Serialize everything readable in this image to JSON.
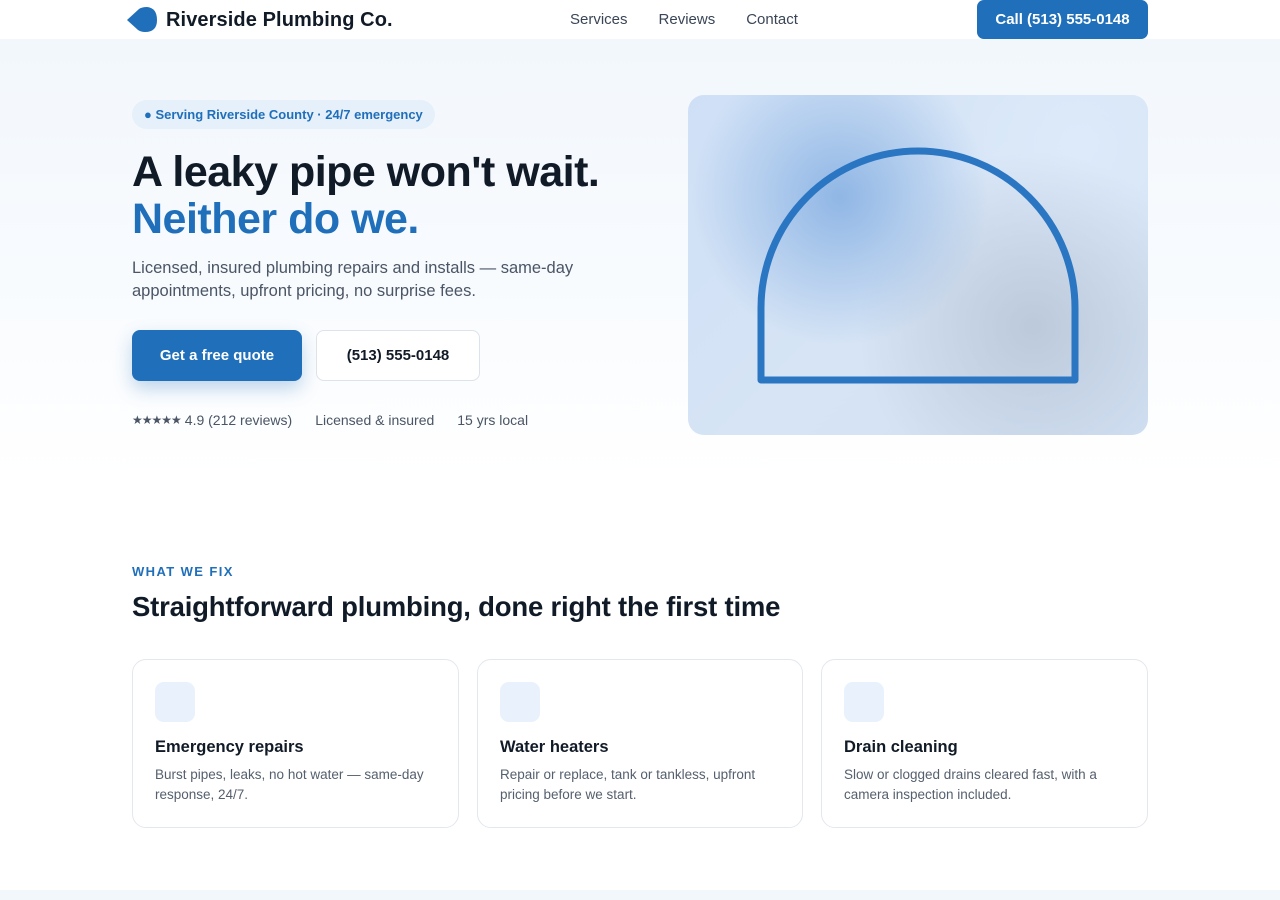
{
  "nav": {
    "brand_name": "Riverside Plumbing Co.",
    "brand_icon": "water-drop-icon",
    "links": [
      "Services",
      "Reviews",
      "Contact"
    ],
    "call_label": "Call (513) 555-0148"
  },
  "hero": {
    "pill": "● Serving Riverside County · 24/7 emergency",
    "headline_line1": "A leaky pipe won't wait.",
    "headline_line2": "Neither do we.",
    "lede": "Licensed, insured plumbing repairs and installs — same-day appointments, upfront pricing, no surprise fees.",
    "primary_cta": "Get a free quote",
    "secondary_cta": "(513) 555-0148",
    "trust": {
      "stars": "★★★★★",
      "rating": "4.9 (212 reviews)",
      "licensed": "Licensed & insured",
      "years": "15 yrs local"
    },
    "art_icon": "arch-pipe-icon"
  },
  "services": {
    "eyebrow": "WHAT WE FIX",
    "title": "Straightforward plumbing, done right the first time",
    "cards": [
      {
        "title": "Emergency repairs",
        "text": "Burst pipes, leaks, no hot water — same-day response, 24/7."
      },
      {
        "title": "Water heaters",
        "text": "Repair or replace, tank or tankless, upfront pricing before we start."
      },
      {
        "title": "Drain cleaning",
        "text": "Slow or clogged drains cleared fast, with a camera inspection included."
      }
    ]
  },
  "colors": {
    "accent": "#1f6fba",
    "ink": "#111b27",
    "muted": "#4a5565"
  }
}
